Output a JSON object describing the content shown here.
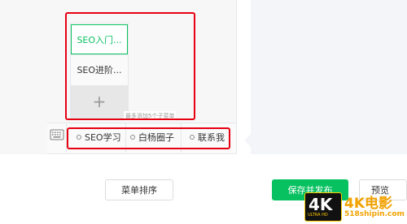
{
  "submenu": {
    "items": [
      {
        "label": "SEO入门..."
      },
      {
        "label": "SEO进阶..."
      }
    ],
    "add_symbol": "+",
    "tip": "最多添加5个子菜单"
  },
  "menubar": {
    "items": [
      {
        "label": "SEO学习"
      },
      {
        "label": "白杨圈子"
      },
      {
        "label": "联系我"
      }
    ]
  },
  "footer": {
    "sort_label": "菜单排序",
    "save_label": "保存并发布",
    "preview_label": "预览"
  },
  "watermark": {
    "badge": "4K",
    "badge_sub": "ULTRA HD",
    "title": "4K电影",
    "url": "518shipin.com"
  },
  "colors": {
    "accent": "#07c160",
    "highlight": "#e60012",
    "panel": "#f4f5f9"
  }
}
